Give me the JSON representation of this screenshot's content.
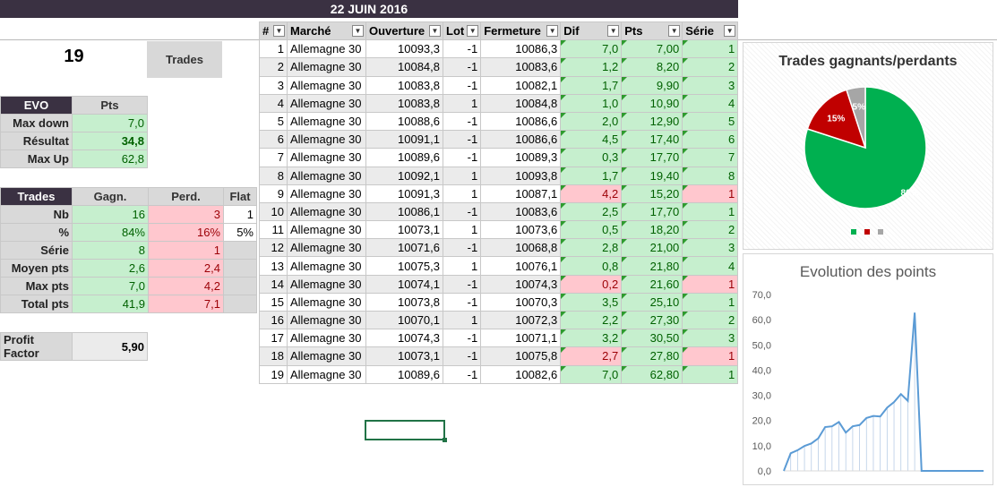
{
  "banner": {
    "date": "22 JUIN 2016"
  },
  "summary": {
    "count": "19",
    "trades_button": "Trades"
  },
  "evo": {
    "header": "EVO",
    "col": "Pts",
    "rows": [
      {
        "label": "Max down",
        "value": "7,0"
      },
      {
        "label": "Résultat",
        "value": "34,8"
      },
      {
        "label": "Max Up",
        "value": "62,8"
      }
    ]
  },
  "stats": {
    "header": "Trades",
    "cols": [
      "Gagn.",
      "Perd.",
      "Flat"
    ],
    "rows": [
      {
        "label": "Nb",
        "g": "16",
        "p": "3",
        "f": "1"
      },
      {
        "label": "%",
        "g": "84%",
        "p": "16%",
        "f": "5%"
      },
      {
        "label": "Série",
        "g": "8",
        "p": "1",
        "f": ""
      },
      {
        "label": "Moyen pts",
        "g": "2,6",
        "p": "2,4",
        "f": ""
      },
      {
        "label": "Max pts",
        "g": "7,0",
        "p": "4,2",
        "f": ""
      },
      {
        "label": "Total pts",
        "g": "41,9",
        "p": "7,1",
        "f": ""
      }
    ]
  },
  "profit": {
    "label": "Profit Factor",
    "value": "5,90"
  },
  "table": {
    "headers": [
      "#",
      "Marché",
      "Ouverture",
      "Lot",
      "Fermeture",
      "Dif",
      "Pts",
      "Série"
    ],
    "rows": [
      [
        "1",
        "Allemagne 30",
        "10093,3",
        "-1",
        "10086,3",
        "7,0",
        "7,00",
        "1"
      ],
      [
        "2",
        "Allemagne 30",
        "10084,8",
        "-1",
        "10083,6",
        "1,2",
        "8,20",
        "2"
      ],
      [
        "3",
        "Allemagne 30",
        "10083,8",
        "-1",
        "10082,1",
        "1,7",
        "9,90",
        "3"
      ],
      [
        "4",
        "Allemagne 30",
        "10083,8",
        "1",
        "10084,8",
        "1,0",
        "10,90",
        "4"
      ],
      [
        "5",
        "Allemagne 30",
        "10088,6",
        "-1",
        "10086,6",
        "2,0",
        "12,90",
        "5"
      ],
      [
        "6",
        "Allemagne 30",
        "10091,1",
        "-1",
        "10086,6",
        "4,5",
        "17,40",
        "6"
      ],
      [
        "7",
        "Allemagne 30",
        "10089,6",
        "-1",
        "10089,3",
        "0,3",
        "17,70",
        "7"
      ],
      [
        "8",
        "Allemagne 30",
        "10092,1",
        "1",
        "10093,8",
        "1,7",
        "19,40",
        "8"
      ],
      [
        "9",
        "Allemagne 30",
        "10091,3",
        "1",
        "10087,1",
        "4,2",
        "15,20",
        "1"
      ],
      [
        "10",
        "Allemagne 30",
        "10086,1",
        "-1",
        "10083,6",
        "2,5",
        "17,70",
        "1"
      ],
      [
        "11",
        "Allemagne 30",
        "10073,1",
        "1",
        "10073,6",
        "0,5",
        "18,20",
        "2"
      ],
      [
        "12",
        "Allemagne 30",
        "10071,6",
        "-1",
        "10068,8",
        "2,8",
        "21,00",
        "3"
      ],
      [
        "13",
        "Allemagne 30",
        "10075,3",
        "1",
        "10076,1",
        "0,8",
        "21,80",
        "4"
      ],
      [
        "14",
        "Allemagne 30",
        "10074,1",
        "-1",
        "10074,3",
        "0,2",
        "21,60",
        "1"
      ],
      [
        "15",
        "Allemagne 30",
        "10073,8",
        "-1",
        "10070,3",
        "3,5",
        "25,10",
        "1"
      ],
      [
        "16",
        "Allemagne 30",
        "10070,1",
        "1",
        "10072,3",
        "2,2",
        "27,30",
        "2"
      ],
      [
        "17",
        "Allemagne 30",
        "10074,3",
        "-1",
        "10071,1",
        "3,2",
        "30,50",
        "3"
      ],
      [
        "18",
        "Allemagne 30",
        "10073,1",
        "-1",
        "10075,8",
        "2,7",
        "27,80",
        "1"
      ],
      [
        "19",
        "Allemagne 30",
        "10089,6",
        "-1",
        "10082,6",
        "7,0",
        "62,80",
        "1"
      ]
    ],
    "losses": [
      9,
      14,
      18
    ]
  },
  "colors": {
    "win": "#00b050",
    "loss": "#c00000",
    "flat": "#a6a6a6",
    "line": "#5b9bd5"
  },
  "chart_data": [
    {
      "type": "pie",
      "title": "Trades gagnants/perdants",
      "categories": [
        "",
        "",
        ""
      ],
      "values": [
        80,
        15,
        5
      ],
      "labels": [
        "80%",
        "15%",
        "5%"
      ]
    },
    {
      "type": "line",
      "title": "Evolution des points",
      "x": [
        1,
        2,
        3,
        4,
        5,
        6,
        7,
        8,
        9,
        10,
        11,
        12,
        13,
        14,
        15,
        16,
        17,
        18,
        19,
        20,
        21,
        22,
        23,
        24,
        25,
        26,
        27,
        28,
        29,
        30
      ],
      "values": [
        0,
        7,
        8.2,
        9.9,
        10.9,
        12.9,
        17.4,
        17.7,
        19.4,
        15.2,
        17.7,
        18.2,
        21,
        21.8,
        21.6,
        25.1,
        27.3,
        30.5,
        27.8,
        62.8,
        0,
        0,
        0,
        0,
        0,
        0,
        0,
        0,
        0,
        0
      ],
      "yticks": [
        "0,0",
        "10,0",
        "20,0",
        "30,0",
        "40,0",
        "50,0",
        "60,0",
        "70,0"
      ],
      "ylim": [
        0,
        70
      ]
    }
  ]
}
